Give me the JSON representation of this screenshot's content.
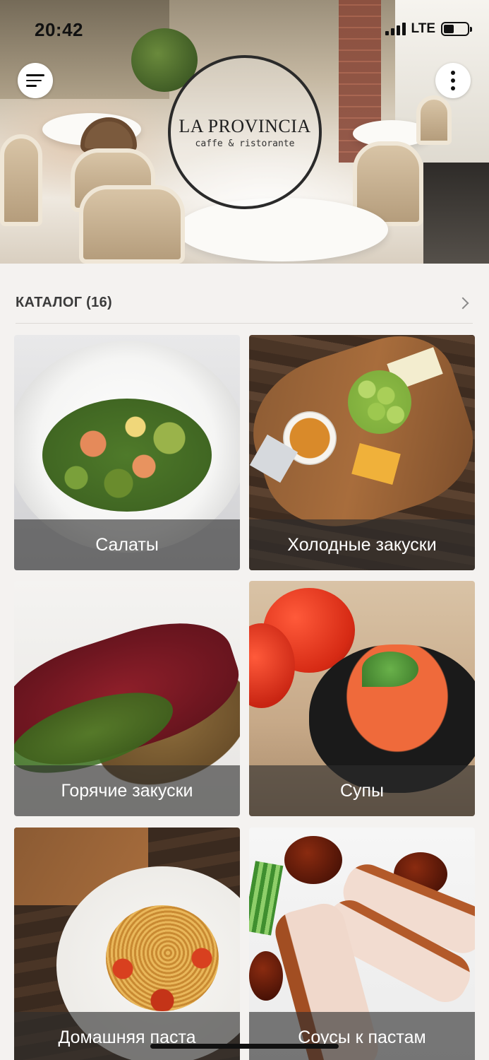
{
  "status_bar": {
    "time": "20:42",
    "network": "LTE",
    "signal_bars": 4,
    "battery_level": 0.45
  },
  "header": {
    "menu_icon": "hamburger-menu-icon",
    "more_icon": "vertical-dots-icon",
    "logo": {
      "name": "LA PROVINCIA",
      "subtitle": "caffe & ristorante"
    }
  },
  "catalog": {
    "title": "КАТАЛОГ (16)",
    "chevron_icon": "chevron-right-icon",
    "items": [
      {
        "label": "Салаты",
        "image": "salad-photo"
      },
      {
        "label": "Холодные закуски",
        "image": "cheese-board-photo"
      },
      {
        "label": "Горячие закуски",
        "image": "carpaccio-photo"
      },
      {
        "label": "Супы",
        "image": "tomato-soup-photo"
      },
      {
        "label": "Домашняя паста",
        "image": "spaghetti-photo"
      },
      {
        "label": "Соусы к пастам",
        "image": "duck-sauce-photo"
      }
    ]
  },
  "colors": {
    "background": "#f4f2f0",
    "caption_overlay": "rgba(45,45,45,0.62)",
    "text_dark": "#3b3b3b"
  }
}
